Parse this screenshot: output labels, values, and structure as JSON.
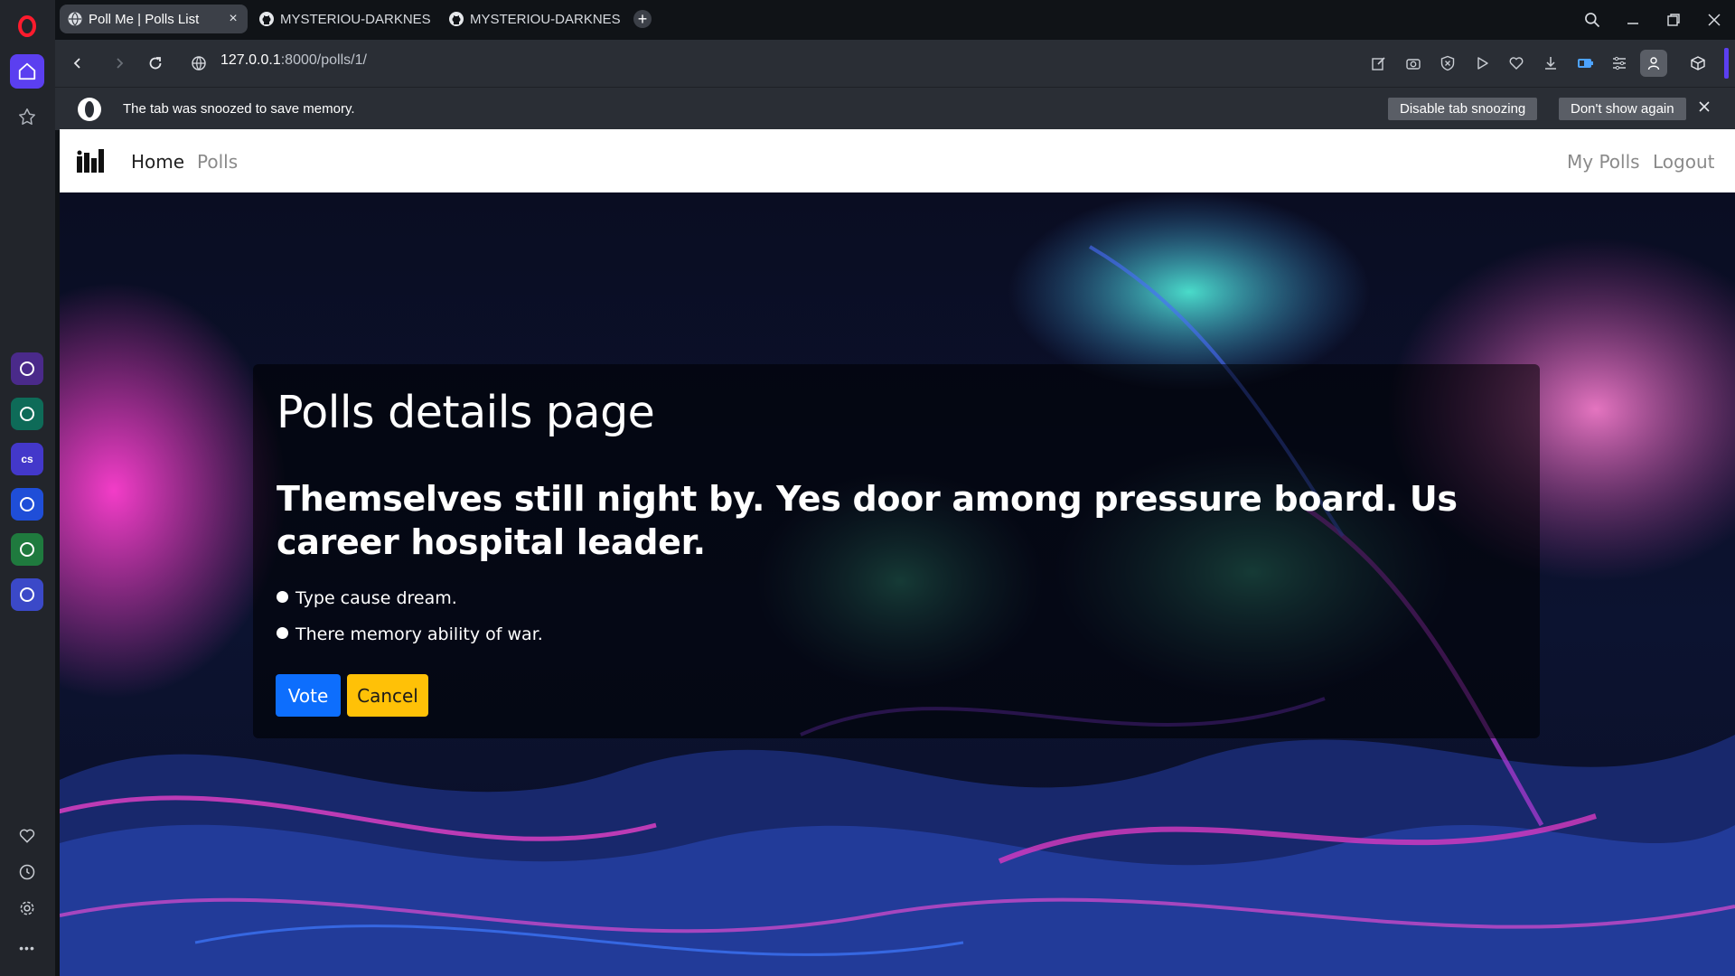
{
  "browser": {
    "tabs": [
      {
        "title": "Poll Me | Polls List",
        "active": true
      },
      {
        "title": "MYSTERIOU-DARKNESS/V",
        "active": false
      },
      {
        "title": "MYSTERIOU-DARKNESS/V",
        "active": false
      }
    ],
    "new_tab_label": "+",
    "url_host": "127.0.0.1",
    "url_path": ":8000/polls/1/",
    "snooze_message": "The tab was snoozed to save memory.",
    "snooze_buttons": {
      "disable": "Disable tab snoozing",
      "dont_show": "Don't show again"
    },
    "sidebar_apps": [
      {
        "name": "aria",
        "color": "#4a2a8a",
        "label": ""
      },
      {
        "name": "chatgpt",
        "color": "#0e6b58",
        "label": ""
      },
      {
        "name": "cs",
        "color": "#4338ca",
        "label": "cs"
      },
      {
        "name": "messenger",
        "color": "#1f4ed8",
        "label": ""
      },
      {
        "name": "whatsapp",
        "color": "#1f7a3e",
        "label": ""
      },
      {
        "name": "discord",
        "color": "#3b49c8",
        "label": ""
      }
    ],
    "sidebar_more_label": "•••"
  },
  "site": {
    "nav": {
      "home": "Home",
      "polls": "Polls",
      "my_polls": "My Polls",
      "logout": "Logout"
    },
    "page_title": "Polls details page",
    "question": "Themselves still night by. Yes door among pressure board. Us career hospital leader.",
    "choices": [
      "Type cause dream.",
      "There memory ability of war."
    ],
    "vote_label": "Vote",
    "cancel_label": "Cancel"
  },
  "colors": {
    "vote_button": "#0d6efd",
    "cancel_button": "#ffc107",
    "nav_active": "#222222",
    "nav_muted": "#8a8a8a"
  }
}
